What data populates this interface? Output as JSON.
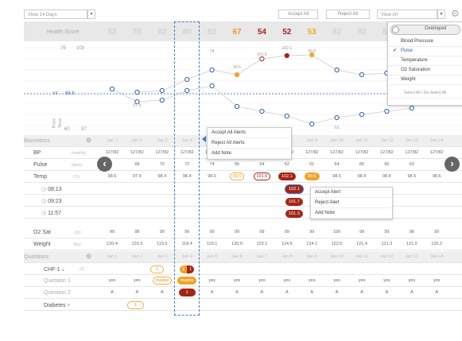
{
  "toolbar": {
    "range_select": "View 14 Days",
    "accept_all": "Accept All",
    "reject_all": "Reject All",
    "view_select": "View All"
  },
  "header": {
    "health_score_label": "Health Score",
    "scores": [
      "82",
      "78",
      "82",
      "80",
      "82",
      "67",
      "54",
      "52",
      "53",
      "82",
      "82",
      "82",
      "82",
      "82"
    ]
  },
  "chart": {
    "left_labels": {
      "upper_a": "76",
      "upper_b": "103",
      "mid_a": "68",
      "mid_b": "98.6",
      "low_a": "60",
      "low_b": "97",
      "pulse_tag": "Pulse",
      "temp_tag": "Temp"
    },
    "point_labels": [
      "74",
      "99.5",
      "101.6",
      "102.1",
      "99.6",
      "97.9",
      "61"
    ]
  },
  "overlay_menu": {
    "toggle_label": "Overlayed",
    "items": [
      "Blood Pressure",
      "Pulse",
      "Temperature",
      "O2 Saturation",
      "Weight",
      "Select All / De-Select All"
    ],
    "checked": "Pulse"
  },
  "sections": {
    "biometrics": "Biometrics",
    "questions": "Questions"
  },
  "dates": [
    "Jan 1",
    "Jan 2",
    "Jan 3",
    "Jan 4",
    "Jan 5",
    "Jan 6",
    "Jan 7",
    "Jan 8",
    "Jan 9",
    "Jan 10",
    "Jan 11",
    "Jan 12",
    "Jan 13",
    "Jan 14"
  ],
  "rows": {
    "bp": {
      "label": "BP",
      "unit": "(mmHg)",
      "values": [
        "127/82",
        "127/82",
        "127/82",
        "127/82",
        "127/82",
        "127/82",
        "127/82",
        "127/82",
        "127/82",
        "127/82",
        "127/82",
        "127/82",
        "127/82",
        "127/82"
      ]
    },
    "pulse": {
      "label": "Pulse",
      "unit": "(bpm)",
      "values": [
        "",
        "68",
        "70",
        "72",
        "74",
        "65",
        "54",
        "62",
        "61",
        "64",
        "65",
        "65",
        "63",
        ""
      ]
    },
    "temp": {
      "label": "Temp",
      "unit": "(°F)",
      "values": [
        "98.6",
        "97.9",
        "98.4",
        "98.4",
        "98.6",
        "99.5",
        "101.6",
        "102.1",
        "99.6",
        "98.5",
        "98.4",
        "98.4",
        "98.5",
        "98.6"
      ]
    },
    "times": [
      "08:13",
      "09:23",
      "11:57"
    ],
    "temp_subvalues": [
      "102.1",
      "101.7",
      "101.3"
    ],
    "o2": {
      "label": "O2 Sat",
      "unit": "(%)",
      "values": [
        "99",
        "98",
        "99",
        "99",
        "99",
        "99",
        "99",
        "99",
        "99",
        "100",
        "99",
        "99",
        "98",
        "99"
      ]
    },
    "weight": {
      "label": "Weight",
      "unit": "(lbs)",
      "values": [
        "120.4",
        "120.2",
        "119.5",
        "118.4",
        "119.1",
        "120.0",
        "123.1",
        "124.5",
        "124.1",
        "122.0",
        "121.4",
        "121.3",
        "121.0",
        "120.2"
      ]
    }
  },
  "questions": {
    "chf": {
      "label": "CHF-1",
      "count": "(2)",
      "badges": [
        "1",
        "1"
      ]
    },
    "q1": {
      "label": "Question 1",
      "values": [
        "yes",
        "yes",
        "maybe",
        "maybe",
        "yes",
        "yes",
        "yes",
        "yes",
        "yes",
        "yes",
        "yes",
        "yes",
        "yes",
        "yes"
      ]
    },
    "q2": {
      "label": "Question 2",
      "values": [
        "A",
        "A",
        "A",
        "1",
        "A",
        "A",
        "A",
        "A",
        "A",
        "A",
        "A",
        "A",
        "A",
        "A"
      ]
    },
    "diabetes": {
      "label": "Diabetes",
      "badge": "1"
    }
  },
  "context_menu_left": [
    "Accept All Alerts",
    "Reject All Alerts",
    "Add Note"
  ],
  "context_menu_right": [
    "Accept Alert",
    "Reject Alert",
    "Add Note"
  ],
  "colors": {
    "alert_red": "#a52418",
    "warn_orange": "#f0a22a",
    "selection_blue": "#3a7ad0",
    "line_blue": "#2b5fb4"
  }
}
